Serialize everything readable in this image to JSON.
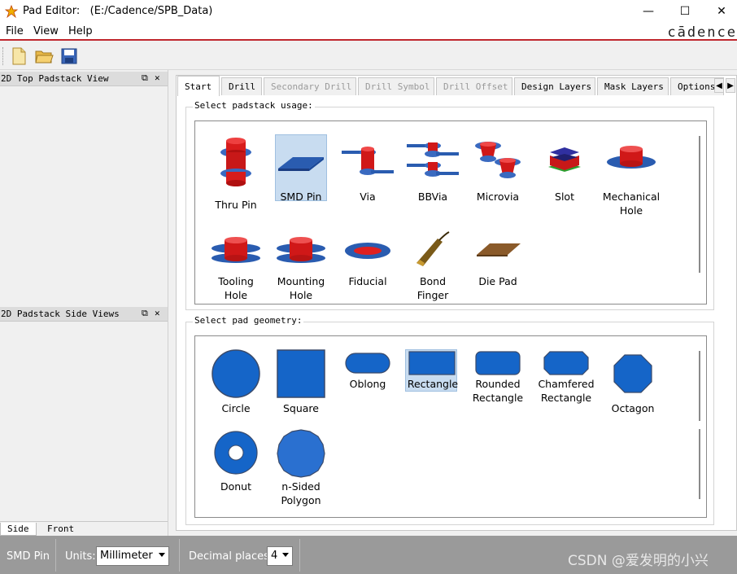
{
  "window": {
    "app_name": "Pad Editor:",
    "path": "(E:/Cadence/SPB_Data)",
    "minimize": "—",
    "maximize": "☐",
    "close": "✕"
  },
  "menu": [
    "File",
    "View",
    "Help"
  ],
  "brand": "cādence",
  "panels": {
    "top_view_title": "2D Top Padstack View",
    "side_view_title": "2D Padstack Side Views",
    "bottom_tabs": [
      "Side",
      "Front"
    ]
  },
  "tabs": [
    {
      "label": "Start",
      "state": "active"
    },
    {
      "label": "Drill",
      "state": "normal"
    },
    {
      "label": "Secondary Drill",
      "state": "disabled"
    },
    {
      "label": "Drill Symbol",
      "state": "disabled"
    },
    {
      "label": "Drill Offset",
      "state": "disabled"
    },
    {
      "label": "Design Layers",
      "state": "normal"
    },
    {
      "label": "Mask Layers",
      "state": "normal"
    },
    {
      "label": "Options",
      "state": "normal"
    }
  ],
  "usage": {
    "label": "Select padstack usage:",
    "selected": "SMD Pin",
    "items": [
      {
        "label1": "Thru Pin",
        "label2": "",
        "icon": "thru-pin-icon"
      },
      {
        "label1": "SMD Pin",
        "label2": "",
        "icon": "smd-pin-icon"
      },
      {
        "label1": "Via",
        "label2": "",
        "icon": "via-icon"
      },
      {
        "label1": "BBVia",
        "label2": "",
        "icon": "bbvia-icon"
      },
      {
        "label1": "Microvia",
        "label2": "",
        "icon": "microvia-icon"
      },
      {
        "label1": "Slot",
        "label2": "",
        "icon": "slot-icon"
      },
      {
        "label1": "Mechanical",
        "label2": "Hole",
        "icon": "mechanical-hole-icon"
      },
      {
        "label1": "Tooling",
        "label2": "Hole",
        "icon": "tooling-hole-icon"
      },
      {
        "label1": "Mounting",
        "label2": "Hole",
        "icon": "mounting-hole-icon"
      },
      {
        "label1": "Fiducial",
        "label2": "",
        "icon": "fiducial-icon"
      },
      {
        "label1": "Bond",
        "label2": "Finger",
        "icon": "bond-finger-icon"
      },
      {
        "label1": "Die Pad",
        "label2": "",
        "icon": "die-pad-icon"
      }
    ]
  },
  "geometry": {
    "label": "Select pad geometry:",
    "selected": "Rectangle",
    "items": [
      {
        "label1": "Circle",
        "label2": "",
        "icon": "circle-icon"
      },
      {
        "label1": "Square",
        "label2": "",
        "icon": "square-icon"
      },
      {
        "label1": "Oblong",
        "label2": "",
        "icon": "oblong-icon"
      },
      {
        "label1": "Rectangle",
        "label2": "",
        "icon": "rectangle-icon"
      },
      {
        "label1": "Rounded",
        "label2": "Rectangle",
        "icon": "rounded-rectangle-icon"
      },
      {
        "label1": "Chamfered",
        "label2": "Rectangle",
        "icon": "chamfered-rectangle-icon"
      },
      {
        "label1": "Octagon",
        "label2": "",
        "icon": "octagon-icon"
      },
      {
        "label1": "Donut",
        "label2": "",
        "icon": "donut-icon"
      },
      {
        "label1": "n-Sided",
        "label2": "Polygon",
        "icon": "n-sided-polygon-icon"
      }
    ]
  },
  "status": {
    "usage": "SMD Pin",
    "units_label": "Units:",
    "units_value": "Millimeter",
    "decimal_label": "Decimal places:",
    "decimal_value": "4"
  },
  "watermark": "CSDN @爱发明的小兴",
  "colors": {
    "pad_blue": "#1565c8",
    "copper_red": "#d01818",
    "selection": "#c8dcf0",
    "accent_line": "#c0272d"
  }
}
